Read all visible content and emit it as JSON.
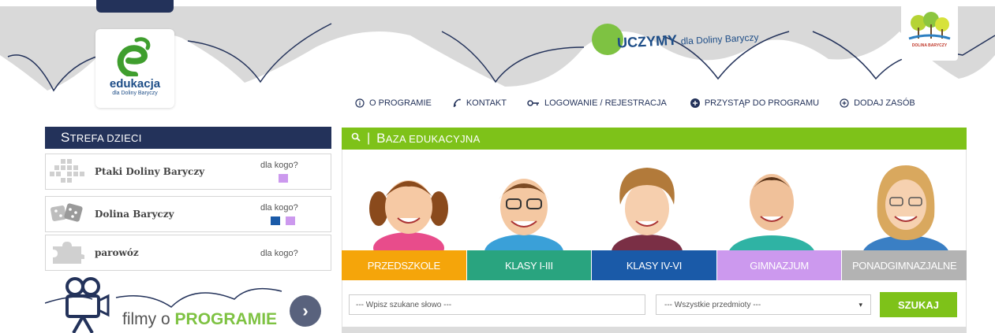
{
  "header": {
    "logo_word": "edukacja",
    "logo_sub": "dla Doliny Baryczy",
    "tagline_main": "UCZYMY",
    "tagline_rest": "dla Doliny Baryczy",
    "dolina_logo_caption": "DOLINA BARYCZY"
  },
  "nav": [
    {
      "label": "O PROGRAMIE",
      "icon": "info-icon"
    },
    {
      "label": "KONTAKT",
      "icon": "phone-icon"
    },
    {
      "label": "LOGOWANIE / REJESTRACJA",
      "icon": "key-icon"
    },
    {
      "label": "PRZYSTĄP DO PROGRAMU",
      "icon": "plus-circle-filled-icon"
    },
    {
      "label": "DODAJ ZASÓB",
      "icon": "plus-circle-icon"
    }
  ],
  "strefa": {
    "title": "STREFA DZIECI",
    "games": [
      {
        "name": "Ptaki Doliny Baryczy",
        "for_whom": "dla kogo?",
        "colors": [
          "#cc99ee"
        ]
      },
      {
        "name": "Dolina Baryczy",
        "for_whom": "dla kogo?",
        "colors": [
          "#1a5aa8",
          "#cc99ee"
        ]
      },
      {
        "name": "parowóz",
        "for_whom": "dla kogo?",
        "colors": []
      }
    ],
    "filmy_prefix": "filmy o",
    "filmy_bold": "PROGRAMIE",
    "filmy_arrow": "›"
  },
  "baza": {
    "title": "BAZA EDUKACYJNA",
    "separator": "|",
    "tiles": [
      {
        "label": "PRZEDSZKOLE",
        "color": "#f5a50a"
      },
      {
        "label": "KLASY I-III",
        "color": "#29a47f"
      },
      {
        "label": "KLASY IV-VI",
        "color": "#1a5aa8"
      },
      {
        "label": "GIMNAZJUM",
        "color": "#cc99ee"
      },
      {
        "label": "PONADGIMNAZJALNE",
        "color": "#b3b3b3"
      }
    ],
    "search_placeholder": "--- Wpisz szukane słowo ---",
    "subject_selected": "--- Wszystkie przedmioty ---",
    "select_caret": "▾",
    "search_button": "SZUKAJ"
  },
  "colors": {
    "navy": "#23325a",
    "green": "#7ec219",
    "sky_cloud": "#d8d8d8"
  }
}
